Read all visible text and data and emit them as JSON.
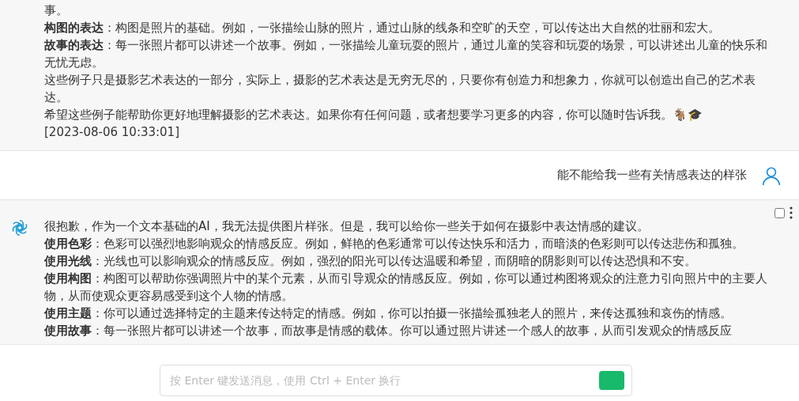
{
  "messages": [
    {
      "kind": "assistant",
      "paragraphs": [
        "事。",
        "**构图的表达**：构图是照片的基础。例如，一张描绘山脉的照片，通过山脉的线条和空旷的天空，可以传达出大自然的壮丽和宏大。",
        "**故事的表达**：每一张照片都可以讲述一个故事。例如，一张描绘儿童玩耍的照片，通过儿童的笑容和玩耍的场景，可以讲述出儿童的快乐和无忧无虑。",
        "这些例子只是摄影艺术表达的一部分，实际上，摄影的艺术表达是无穷无尽的，只要你有创造力和想象力，你就可以创造出自己的艺术表达。",
        "希望这些例子能帮助你更好地理解摄影的艺术表达。如果你有任何问题，或者想要学习更多的内容，你可以随时告诉我。🐐🎓"
      ],
      "timestamp": "[2023-08-06 10:33:01]"
    },
    {
      "kind": "user",
      "paragraphs": [
        "能不能给我一些有关情感表达的样张"
      ]
    },
    {
      "kind": "assistant",
      "avatar": true,
      "checked": false,
      "paragraphs": [
        "很抱歉，作为一个文本基础的AI，我无法提供图片样张。但是，我可以给你一些关于如何在摄影中表达情感的建议。",
        "**使用色彩**：色彩可以强烈地影响观众的情感反应。例如，鲜艳的色彩通常可以传达快乐和活力，而暗淡的色彩则可以传达悲伤和孤独。",
        "**使用光线**：光线也可以影响观众的情感反应。例如，强烈的阳光可以传达温暖和希望，而阴暗的阴影则可以传达恐惧和不安。",
        "**使用构图**：构图可以帮助你强调照片中的某个元素，从而引导观众的情感反应。例如，你可以通过构图将观众的注意力引向照片中的主要人物，从而使观众更容易感受到这个人物的情感。",
        "**使用主题**：你可以通过选择特定的主题来传达特定的情感。例如，你可以拍摄一张描绘孤独老人的照片，来传达孤独和哀伤的情感。",
        "**使用故事**：每一张照片都可以讲述一个故事，而故事是情感的载体。你可以通过照片讲述一个感人的故事，从而引发观众的情感反应"
      ]
    }
  ],
  "composer": {
    "placeholder": "按 Enter 键发送消息，使用 Ctrl + Enter 换行"
  }
}
